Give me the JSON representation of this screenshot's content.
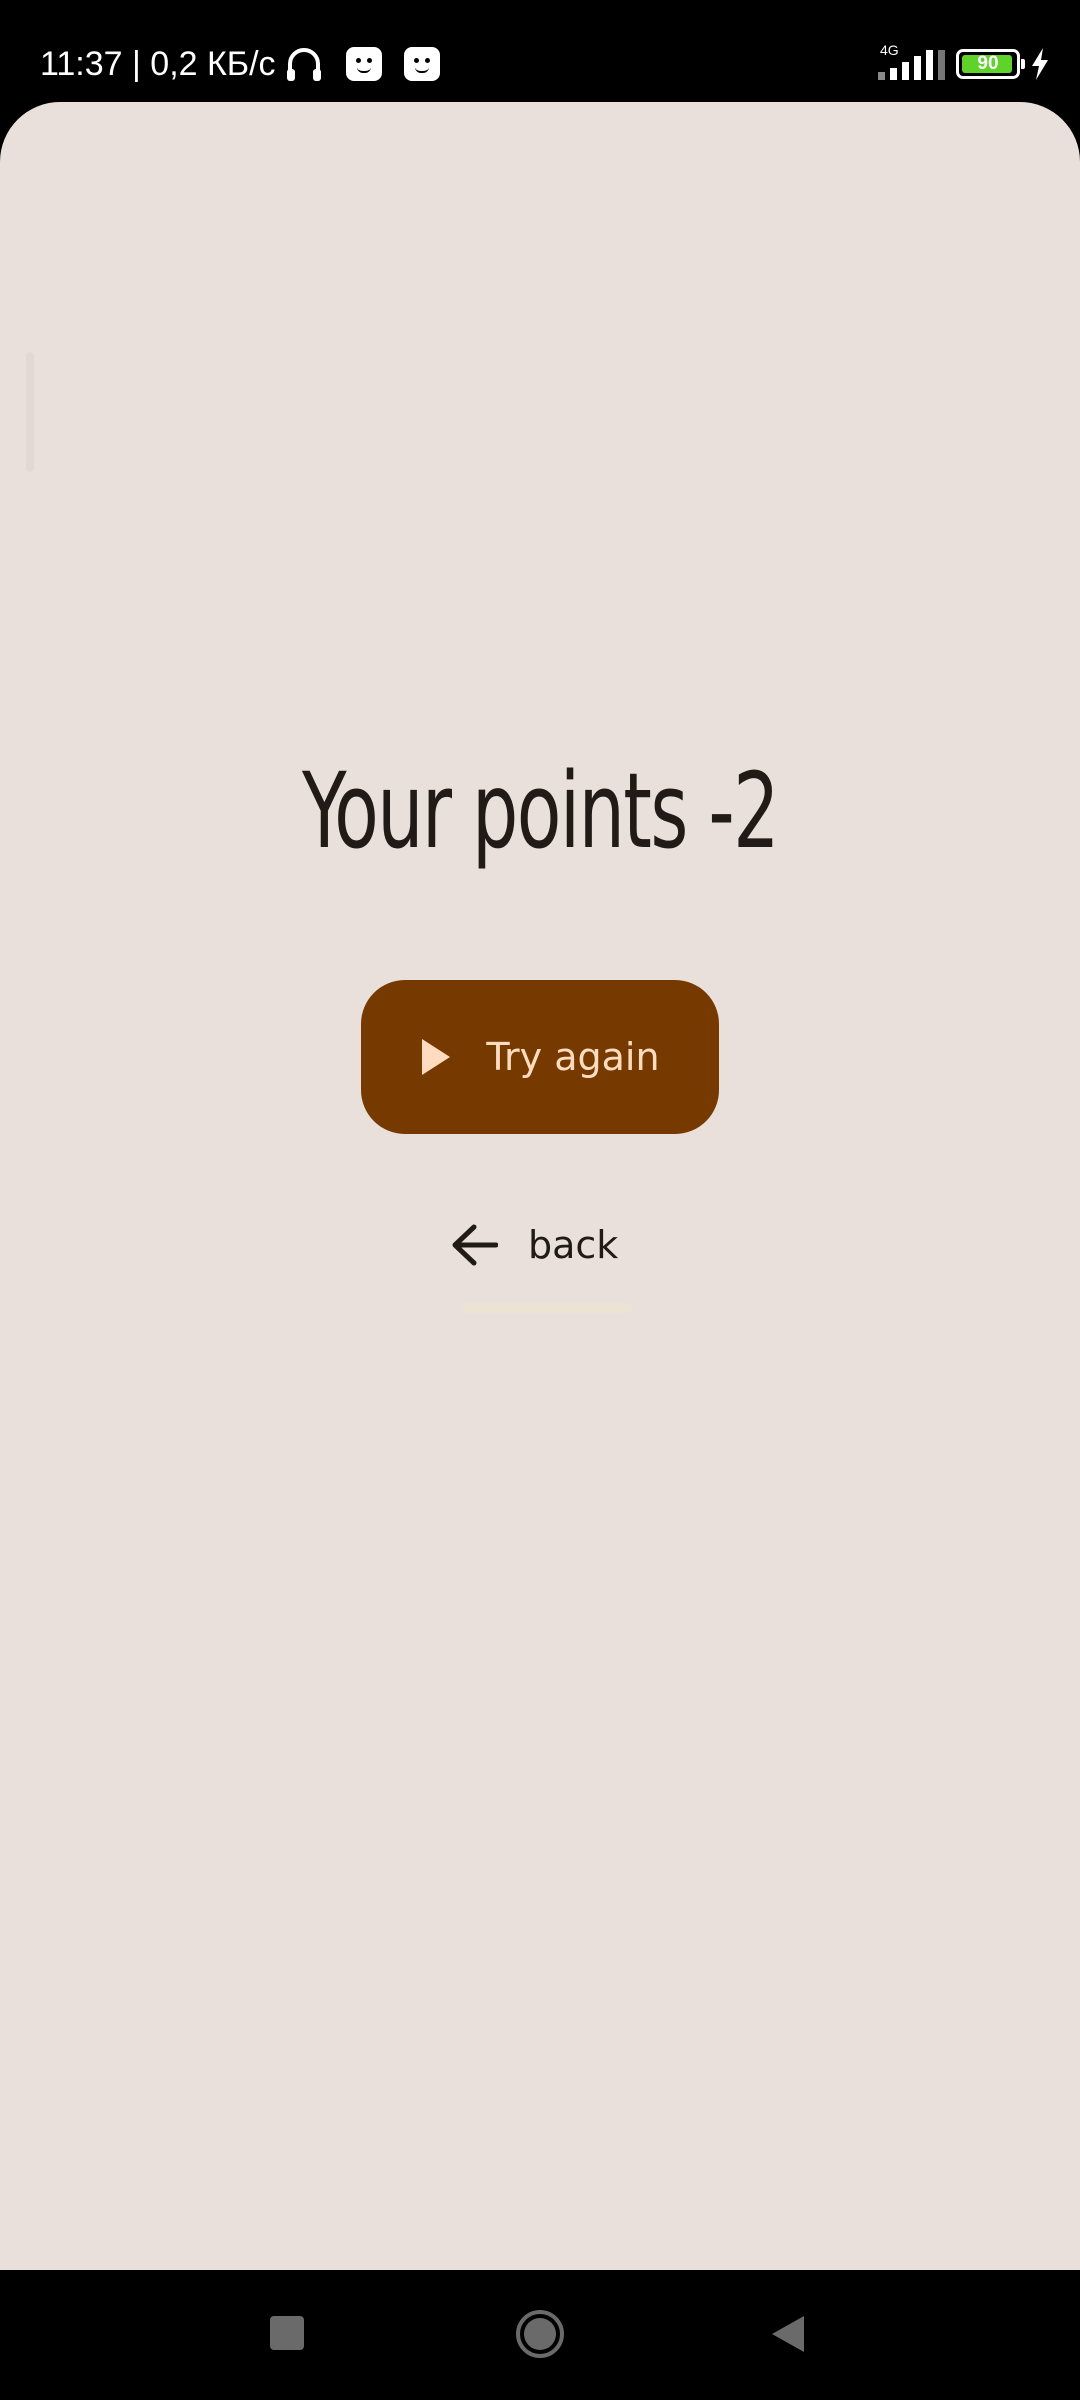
{
  "status_bar": {
    "time_and_speed": "11:37 | 0,2 КБ/с",
    "network_type": "4G",
    "battery_level": "90",
    "icons": [
      "headphones-icon",
      "app-notification-icon",
      "app-notification-icon",
      "signal-icon",
      "battery-icon",
      "charging-bolt-icon"
    ]
  },
  "main": {
    "score_title": "Your points -2",
    "try_again_label": "Try again",
    "back_label": "back"
  },
  "colors": {
    "background": "#eae0db",
    "button": "#763a00",
    "button_text": "#ffdcc0",
    "text": "#211a16"
  },
  "nav_bar": {
    "icons": [
      "recents-icon",
      "home-icon",
      "back-icon"
    ]
  }
}
